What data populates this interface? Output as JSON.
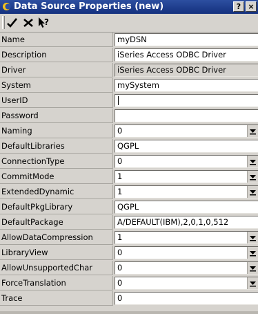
{
  "window": {
    "title": "Data Source Properties (new)",
    "help_btn": "?",
    "close_btn": "×"
  },
  "toolbar": {
    "ok_icon": "checkmark-icon",
    "cancel_icon": "x-icon",
    "help_icon": "whats-this-icon"
  },
  "rows": [
    {
      "name": "Name",
      "value": "myDSN",
      "kind": "text"
    },
    {
      "name": "Description",
      "value": "iSeries Access ODBC Driver",
      "kind": "text"
    },
    {
      "name": "Driver",
      "value": "iSeries Access ODBC Driver",
      "kind": "readonly"
    },
    {
      "name": "System",
      "value": "mySystem",
      "kind": "text"
    },
    {
      "name": "UserID",
      "value": "",
      "kind": "text",
      "focused": true
    },
    {
      "name": "Password",
      "value": "",
      "kind": "text"
    },
    {
      "name": "Naming",
      "value": "0",
      "kind": "select"
    },
    {
      "name": "DefaultLibraries",
      "value": "QGPL",
      "kind": "text"
    },
    {
      "name": "ConnectionType",
      "value": "0",
      "kind": "select"
    },
    {
      "name": "CommitMode",
      "value": "1",
      "kind": "select"
    },
    {
      "name": "ExtendedDynamic",
      "value": "1",
      "kind": "select"
    },
    {
      "name": "DefaultPkgLibrary",
      "value": "QGPL",
      "kind": "text"
    },
    {
      "name": "DefaultPackage",
      "value": "A/DEFAULT(IBM),2,0,1,0,512",
      "kind": "text"
    },
    {
      "name": "AllowDataCompression",
      "value": "1",
      "kind": "select"
    },
    {
      "name": "LibraryView",
      "value": "0",
      "kind": "select"
    },
    {
      "name": "AllowUnsupportedChar",
      "value": "0",
      "kind": "select"
    },
    {
      "name": "ForceTranslation",
      "value": "0",
      "kind": "select"
    },
    {
      "name": "Trace",
      "value": "0",
      "kind": "text"
    }
  ]
}
